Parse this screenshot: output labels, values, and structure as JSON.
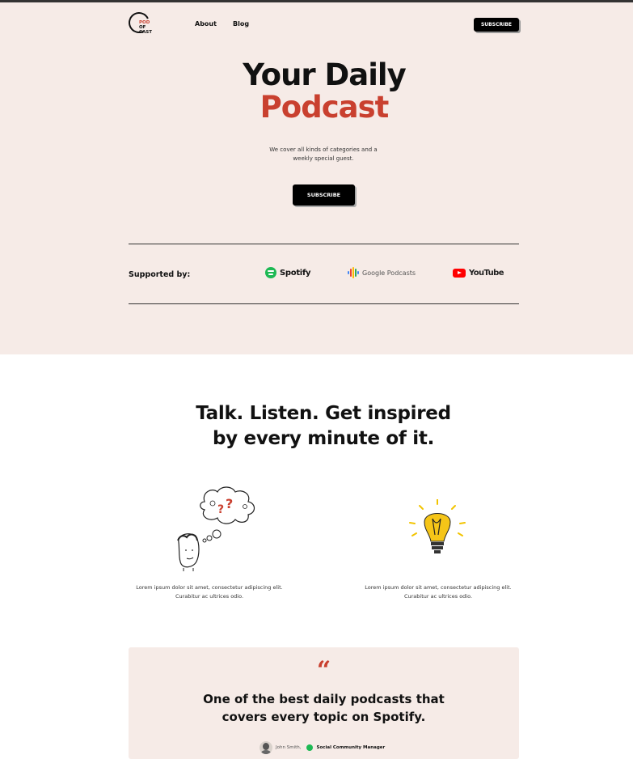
{
  "nav": {
    "logo_lines": [
      "POD",
      "OF",
      "CAST"
    ],
    "about_label": "About",
    "blog_label": "Blog",
    "subscribe_label": "SUBSCRIBE"
  },
  "hero": {
    "title_line1": "Your Daily",
    "title_line2": "Podcast",
    "subtitle": "We cover all kinds of categories and a weekly special guest.",
    "subscribe_label": "SUBSCRIBE"
  },
  "supported": {
    "label": "Supported by:",
    "partners": [
      {
        "name": "Spotify",
        "icon": "spotify-icon"
      },
      {
        "name": "Google Podcasts",
        "icon": "google-podcasts-icon"
      },
      {
        "name": "YouTube",
        "icon": "youtube-icon"
      }
    ]
  },
  "features": {
    "title_line1": "Talk. Listen. Get inspired",
    "title_line2": "by every minute of it.",
    "items": [
      {
        "illustration": "thinking-person-illustration",
        "text": "Lorem ipsum dolor sit amet, consectetur adipiscing elit. Curabitur ac ultrices odio."
      },
      {
        "illustration": "lightbulb-illustration",
        "text": "Lorem ipsum dolor sit amet, consectetur adipiscing elit. Curabitur ac ultrices odio."
      }
    ]
  },
  "testimonial": {
    "quote_mark": "“",
    "quote_line1": "One of the best daily podcasts that",
    "quote_line2": "covers every topic on Spotify.",
    "author_name": "John Smith,",
    "author_role": "Social Community Manager"
  },
  "colors": {
    "accent": "#c9402f",
    "hero_bg": "#f6ebe7",
    "spotify_green": "#1db954",
    "youtube_red": "#ff0000"
  }
}
